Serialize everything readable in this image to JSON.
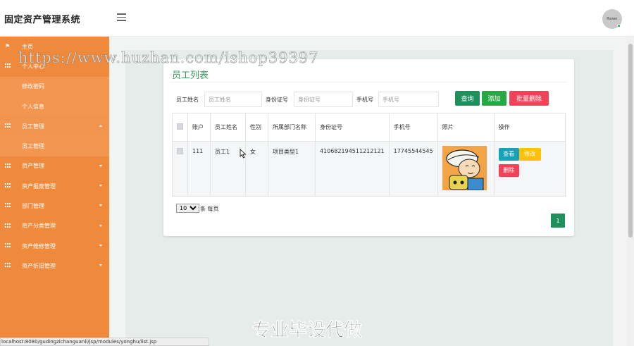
{
  "header": {
    "brand": "固定资产管理系统",
    "avatar_text": "flower"
  },
  "sidebar": {
    "items": [
      {
        "label": "主页",
        "type": "top"
      },
      {
        "label": "个人中心",
        "type": "top"
      },
      {
        "label": "修改密码",
        "type": "sub"
      },
      {
        "label": "个人信息",
        "type": "sub"
      },
      {
        "label": "员工管理",
        "type": "parent-open"
      },
      {
        "label": "员工管理",
        "type": "sub-active"
      },
      {
        "label": "资产管理",
        "type": "parent"
      },
      {
        "label": "资产报废管理",
        "type": "parent"
      },
      {
        "label": "部门管理",
        "type": "parent"
      },
      {
        "label": "资产分类管理",
        "type": "parent"
      },
      {
        "label": "资产维修管理",
        "type": "parent"
      },
      {
        "label": "资产折旧管理",
        "type": "parent"
      }
    ]
  },
  "main": {
    "title": "员工列表",
    "search": {
      "name_label": "员工姓名",
      "name_placeholder": "员工姓名",
      "id_label": "身份证号",
      "id_placeholder": "身份证号",
      "phone_label": "手机号",
      "phone_placeholder": "手机号",
      "search_btn": "查询",
      "add_btn": "添加",
      "batch_delete_btn": "批量删除"
    },
    "table": {
      "headers": [
        "账户",
        "员工姓名",
        "性别",
        "所属部门名称",
        "身份证号",
        "手机号",
        "照片",
        "操作"
      ],
      "rows": [
        {
          "account": "111",
          "name": "员工1",
          "gender": "女",
          "dept": "项目类型1",
          "id_no": "410682194511212121",
          "phone": "17745544545"
        }
      ],
      "ops": {
        "view": "查看",
        "edit": "修改",
        "delete": "删除"
      }
    },
    "pager": {
      "per_page": "10",
      "per_page_suffix": "条 每页",
      "current_page": "1"
    }
  },
  "overlay": {
    "watermark_url": "https://www.huzhan.com/ishop39397",
    "watermark_bottom": "专业毕设代做",
    "status_url": "localhost:8080/gudingzichanguanli/jsp/modules/yonghu/list.jsp"
  },
  "colors": {
    "sidebar": "#ef8a3c",
    "title": "#3a9c5a",
    "primary": "#1f8f5c",
    "success": "#28a745",
    "danger": "#f0435a",
    "info": "#17a2b8",
    "warning": "#ffc107"
  }
}
